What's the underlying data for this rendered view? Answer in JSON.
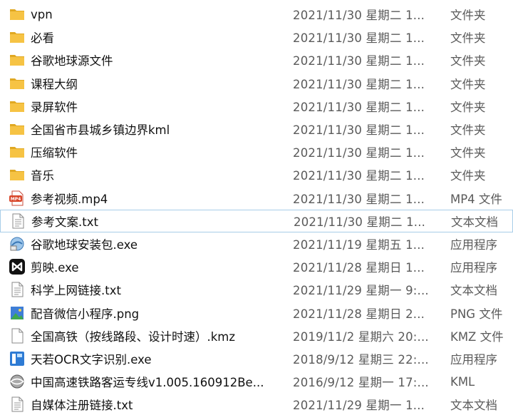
{
  "files": [
    {
      "name": "vpn",
      "date": "2021/11/30 星期二 1...",
      "type": "文件夹",
      "icon": "folder-icon"
    },
    {
      "name": "必看",
      "date": "2021/11/30 星期二 1...",
      "type": "文件夹",
      "icon": "folder-icon"
    },
    {
      "name": "谷歌地球源文件",
      "date": "2021/11/30 星期二 1...",
      "type": "文件夹",
      "icon": "folder-icon"
    },
    {
      "name": "课程大纲",
      "date": "2021/11/30 星期二 1...",
      "type": "文件夹",
      "icon": "folder-icon"
    },
    {
      "name": "录屏软件",
      "date": "2021/11/30 星期二 1...",
      "type": "文件夹",
      "icon": "folder-icon"
    },
    {
      "name": "全国省市县城乡镇边界kml",
      "date": "2021/11/30 星期二 1...",
      "type": "文件夹",
      "icon": "folder-icon"
    },
    {
      "name": "压缩软件",
      "date": "2021/11/30 星期二 1...",
      "type": "文件夹",
      "icon": "folder-icon"
    },
    {
      "name": "音乐",
      "date": "2021/11/30 星期二 1...",
      "type": "文件夹",
      "icon": "folder-icon"
    },
    {
      "name": "参考视频.mp4",
      "date": "2021/11/30 星期二 1...",
      "type": "MP4 文件",
      "icon": "mp4-file-icon"
    },
    {
      "name": "参考文案.txt",
      "date": "2021/11/30 星期二 1...",
      "type": "文本文档",
      "icon": "text-file-icon"
    },
    {
      "name": "谷歌地球安装包.exe",
      "date": "2021/11/19 星期五 1...",
      "type": "应用程序",
      "icon": "installer-icon"
    },
    {
      "name": "剪映.exe",
      "date": "2021/11/28 星期日 1...",
      "type": "应用程序",
      "icon": "capcut-icon"
    },
    {
      "name": "科学上网链接.txt",
      "date": "2021/11/29 星期一 9:...",
      "type": "文本文档",
      "icon": "text-file-icon"
    },
    {
      "name": "配音微信小程序.png",
      "date": "2021/11/28 星期日 2...",
      "type": "PNG 文件",
      "icon": "image-file-icon"
    },
    {
      "name": "全国高铁（按线路段、设计时速）.kmz",
      "date": "2019/11/2 星期六 20:...",
      "type": "KMZ 文件",
      "icon": "blank-file-icon"
    },
    {
      "name": "天若OCR文字识别.exe",
      "date": "2018/9/12 星期三 22:...",
      "type": "应用程序",
      "icon": "ocr-app-icon"
    },
    {
      "name": "中国高速铁路客运专线v1.005.160912Be...",
      "date": "2016/9/12 星期一 17:...",
      "type": "KML",
      "icon": "kml-globe-icon"
    },
    {
      "name": "自媒体注册链接.txt",
      "date": "2021/11/29 星期一 1...",
      "type": "文本文档",
      "icon": "text-file-icon"
    }
  ],
  "selected_index": 9,
  "colors": {
    "folder": "#f6c344",
    "selection_border": "#a8cde8",
    "secondary_text": "#5a5a5a"
  }
}
